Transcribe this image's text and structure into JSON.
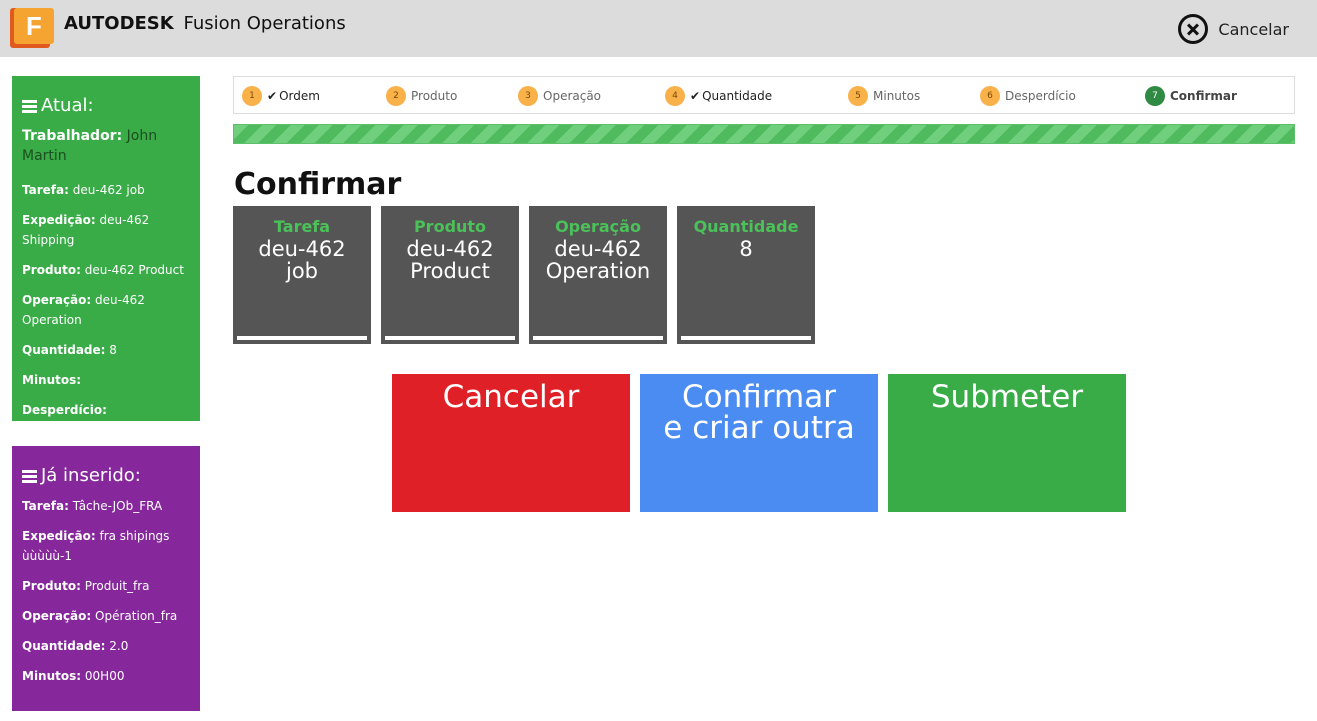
{
  "header": {
    "logo_letter": "F",
    "brand_bold": "AUTODESK",
    "brand_name": "Fusion Operations",
    "cancel_label": "Cancelar"
  },
  "current": {
    "title": "Atual:",
    "worker_label": "Trabalhador",
    "worker_value": "John Martin",
    "fields": [
      {
        "label": "Tarefa",
        "value": "deu-462 job"
      },
      {
        "label": "Expedição",
        "value": "deu-462 Shipping"
      },
      {
        "label": "Produto",
        "value": "deu-462 Product"
      },
      {
        "label": "Operação",
        "value": "deu-462 Operation"
      },
      {
        "label": "Quantidade",
        "value": "8"
      },
      {
        "label": "Minutos",
        "value": ""
      },
      {
        "label": "Desperdício",
        "value": ""
      }
    ]
  },
  "entered": {
    "title": "Já inserido:",
    "fields": [
      {
        "label": "Tarefa",
        "value": "Tâche-JOb_FRA"
      },
      {
        "label": "Expedição",
        "value": "fra shipings ùùùùù-1"
      },
      {
        "label": "Produto",
        "value": "Produit_fra"
      },
      {
        "label": "Operação",
        "value": "Opération_fra"
      },
      {
        "label": "Quantidade",
        "value": "2.0"
      },
      {
        "label": "Minutos",
        "value": "00H00"
      }
    ]
  },
  "steps": [
    {
      "num": "1",
      "label": "Ordem",
      "done": true,
      "check": "✔"
    },
    {
      "num": "2",
      "label": "Produto",
      "done": false,
      "check": ""
    },
    {
      "num": "3",
      "label": "Operação",
      "done": false,
      "check": ""
    },
    {
      "num": "4",
      "label": "Quantidade",
      "done": true,
      "check": "✔"
    },
    {
      "num": "5",
      "label": "Minutos",
      "done": false,
      "check": ""
    },
    {
      "num": "6",
      "label": "Desperdício",
      "done": false,
      "check": ""
    },
    {
      "num": "7",
      "label": "Confirmar",
      "done": false,
      "check": "",
      "active": true
    }
  ],
  "progress_percent": 100,
  "page_title": "Confirmar",
  "cards": [
    {
      "title": "Tarefa",
      "value_lines": [
        "deu-462",
        "job"
      ]
    },
    {
      "title": "Produto",
      "value_lines": [
        "deu-462",
        "Product"
      ]
    },
    {
      "title": "Operação",
      "value_lines": [
        "deu-462",
        "Operation"
      ]
    },
    {
      "title": "Quantidade",
      "value_lines": [
        "8"
      ]
    }
  ],
  "actions": {
    "cancel": "Cancelar",
    "confirm_line1": "Confirmar",
    "confirm_line2": "e criar outra",
    "submit": "Submeter"
  },
  "colors": {
    "accent_green": "#39ac48",
    "accent_purple": "#86289b",
    "cancel_red": "#e02027",
    "confirm_blue": "#4a8cf2",
    "card_gray": "#555555"
  }
}
